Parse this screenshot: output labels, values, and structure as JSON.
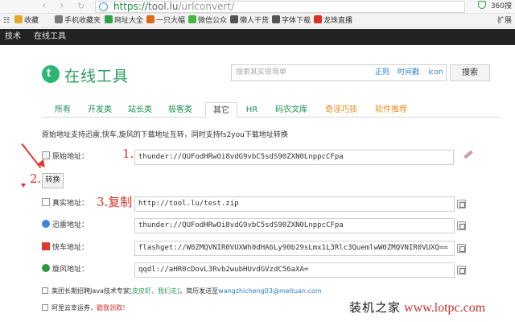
{
  "browser": {
    "url_scheme": "https://",
    "url_host": "tool.lu",
    "url_path": "/urlconvert/",
    "ext_label": "360搜",
    "bookmarks": [
      {
        "label": "收藏",
        "icon": "star-icon",
        "color": "#e3a52b"
      },
      {
        "label": "手机收藏夹",
        "icon": "phone-icon",
        "color": "#7a7a7a"
      },
      {
        "label": "网址大全",
        "icon": "shield-icon",
        "color": "#2ea14a"
      },
      {
        "label": "一只大幅",
        "icon": "plus-icon",
        "color": "#e06a1b"
      },
      {
        "label": "微信公众",
        "icon": "wechat-icon",
        "color": "#46b83f"
      },
      {
        "label": "懒人干货",
        "icon": "bookmark-icon",
        "color": "#555"
      },
      {
        "label": "字体下载",
        "icon": "font-icon",
        "color": "#555"
      },
      {
        "label": "龙珠直播",
        "icon": "dragon-icon",
        "color": "#d8332a"
      }
    ],
    "bm_right": "扩展"
  },
  "site_bar": {
    "items": [
      "技术",
      "在线工具"
    ]
  },
  "header": {
    "logo_text": "在线工具",
    "search_placeholder": "搜索其实很简单",
    "search_links": [
      "正则",
      "时间戳",
      "icon"
    ],
    "search_button": "搜索"
  },
  "tabs": [
    {
      "label": "所有",
      "state": "normal"
    },
    {
      "label": "开发类",
      "state": "normal"
    },
    {
      "label": "站长类",
      "state": "normal"
    },
    {
      "label": "极客类",
      "state": "normal"
    },
    {
      "label": "其它",
      "state": "active"
    },
    {
      "label": "HR",
      "state": "normal"
    },
    {
      "label": "码农文库",
      "state": "normal"
    },
    {
      "label": "奇淫巧技",
      "state": "orange"
    },
    {
      "label": "软件推荐",
      "state": "orange"
    }
  ],
  "description": "原始地址支持迅雷,快车,旋风的下载地址互转，同时支持fs2you下载地址转换",
  "form": {
    "original_label": "原始地址：",
    "original_value": "thunder://QUFodHRwOi8vdG9vbC5sdS90ZXN0LnppcCFpa",
    "convert_button": "转换",
    "real_label": "真实地址：",
    "real_value": "http://tool.lu/test.zip",
    "thunder_label": "迅雷地址：",
    "thunder_value": "thunder://QUFodHRwOi8vdG9vbC5sdS90ZXN0LnppcCFpa",
    "flashget_label": "快车地址：",
    "flashget_value": "flashget://W0ZMQVNIR0VUXWh0dHA6Ly90b29sLmx1L3Rlc3QuemlwW0ZMQVNIR0VUXQ==",
    "qq_label": "旋风地址：",
    "qq_value": "qqdl://aHR0cDovL3Rvb2wubHUvdGVzdC56aXA="
  },
  "annotations": {
    "step1": "1.",
    "step2": "2.",
    "step3": "3.复制"
  },
  "footer": {
    "line1_prefix": "美团长期招聘Java技术专家",
    "line1_link": "[皮皮虾，我们走]",
    "line1_mid": "，简历发送至",
    "line1_email": "wangzhicheng03@meituan.com",
    "line2_prefix": "阿里云幸运券，",
    "line2_link": "戳我领取！"
  },
  "watermark": {
    "brand": "装机之家",
    "url": "www.lotpc.com"
  }
}
